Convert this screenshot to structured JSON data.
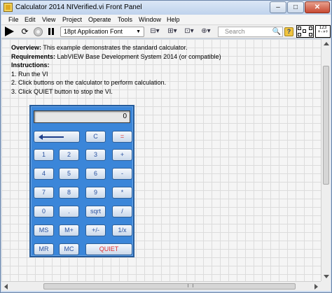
{
  "window": {
    "title": "Calculator 2014 NIVerified.vi Front Panel",
    "minimize": "–",
    "maximize": "□",
    "close": "✕"
  },
  "menu": [
    "File",
    "Edit",
    "View",
    "Project",
    "Operate",
    "Tools",
    "Window",
    "Help"
  ],
  "toolbar": {
    "run_continuous_icon": "⟳",
    "font": "18pt Application Font",
    "font_dropdown": "▼",
    "align_icon": "⊟▾",
    "distribute_icon": "⊞▾",
    "resize_icon": "⊡▾",
    "reorder_icon": "⊕▾",
    "search_placeholder": "Search",
    "search_icon": "🔍",
    "help_icon": "?",
    "vi_icon_text": "123\n+-×÷"
  },
  "description": {
    "overview_label": "Overview:",
    "overview_text": " This example demonstrates the standard calculator.",
    "requirements_label": "Requirements:",
    "requirements_text": " LabVIEW Base Development System 2014 (or compatible)",
    "instructions_label": "Instructions:",
    "step1": "1. Run the VI",
    "step2": "2. Click buttons on the calculator to perform calculation.",
    "step3": "3. Click QUIET button to stop the VI."
  },
  "calculator": {
    "display_value": "0",
    "buttons": {
      "clear": "C",
      "equals": "=",
      "one": "1",
      "two": "2",
      "three": "3",
      "plus": "+",
      "four": "4",
      "five": "5",
      "six": "6",
      "minus": "-",
      "seven": "7",
      "eight": "8",
      "nine": "9",
      "multiply": "*",
      "zero": "0",
      "decimal": ".",
      "sqrt": "sqrt",
      "divide": "/",
      "ms": "MS",
      "mplus": "M+",
      "negate": "+/-",
      "reciprocal": "1/x",
      "mr": "MR",
      "mc": "MC",
      "quiet": "QUIET"
    }
  },
  "colors": {
    "calculator_body": "#3b86d9",
    "button_text": "#2a52a0",
    "red_text": "#e03030"
  }
}
